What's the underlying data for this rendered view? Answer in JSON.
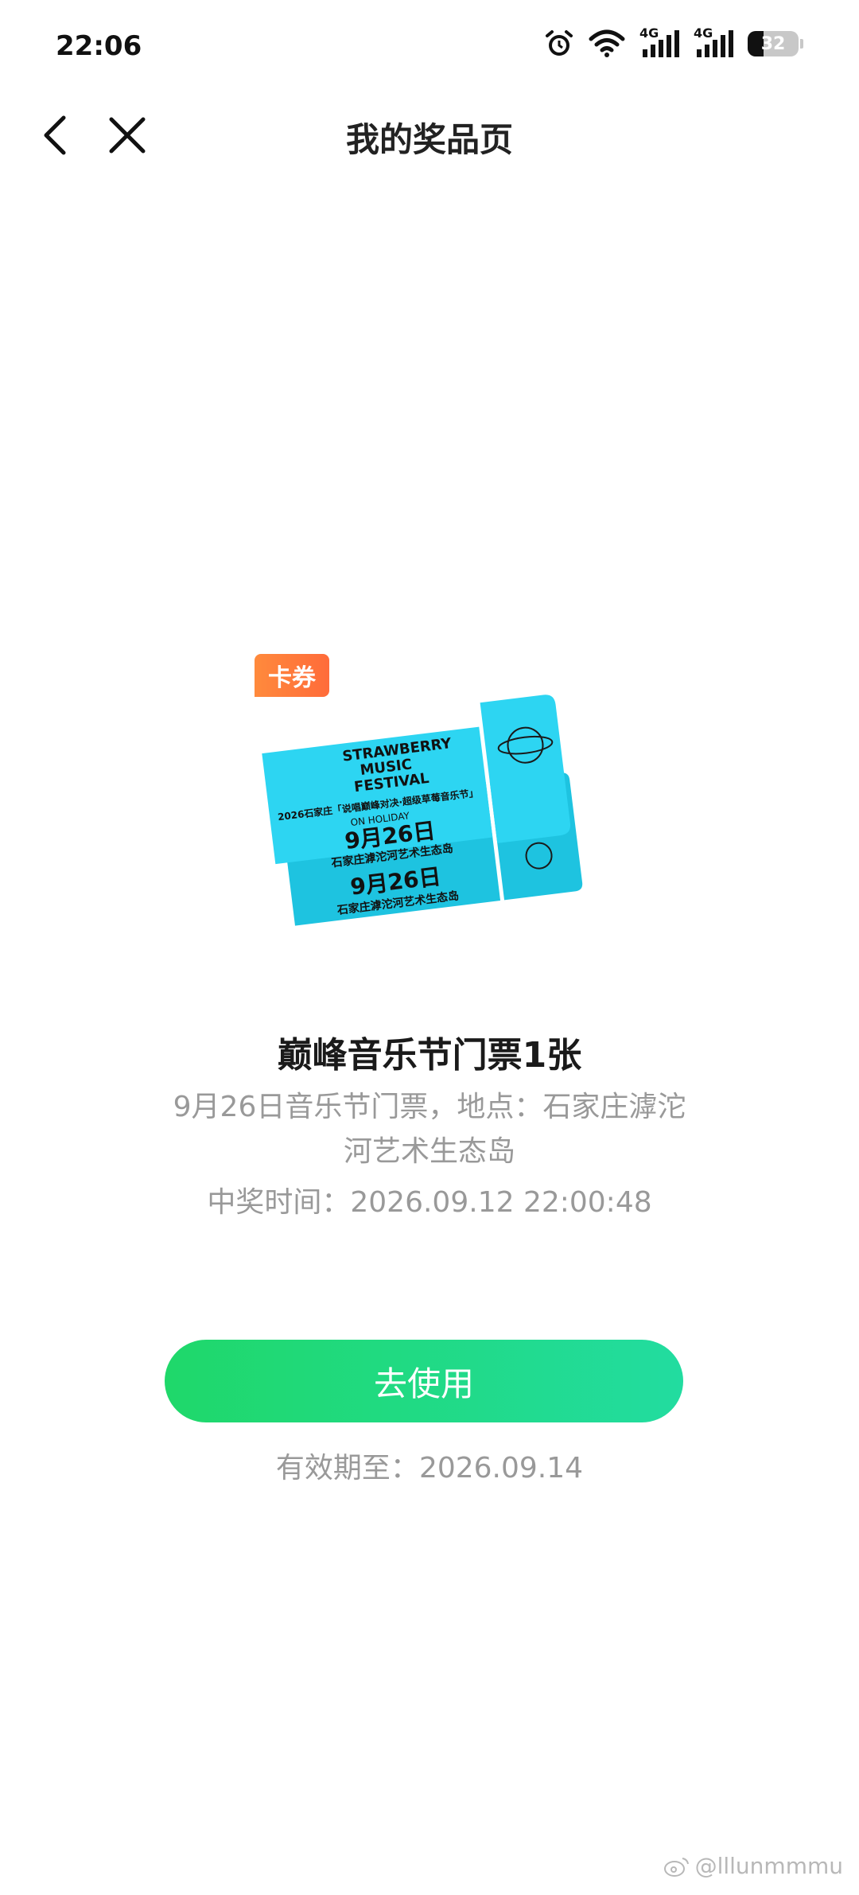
{
  "status_bar": {
    "time": "22:06",
    "network_1": "4G",
    "network_2": "4G",
    "battery_level": "32",
    "battery_fraction": 0.32
  },
  "nav": {
    "title": "我的奖品页",
    "back_icon": "chevron-left-icon",
    "close_icon": "close-icon"
  },
  "prize": {
    "badge": "卡券",
    "ticket_image": {
      "brand_line_1": "STRAWBERRY",
      "brand_line_2": "MUSIC",
      "brand_line_3": "FESTIVAL",
      "event_line": "2026石家庄「说唱巅峰对决·超级草莓音乐节」",
      "subtitle": "ON HOLIDAY",
      "date": "9月26日",
      "venue": "石家庄滹沱河艺术生态岛",
      "color": "#2dd5f2"
    },
    "name": "巅峰音乐节门票1张",
    "description": "9月26日音乐节门票，地点：石家庄滹沱河艺术生态岛",
    "win_time_label": "中奖时间：",
    "win_time_value": "2026.09.12 22:00:48"
  },
  "action": {
    "button_label": "去使用",
    "valid_label": "有效期至：",
    "valid_value": "2026.09.14"
  },
  "watermark": {
    "text": "@lllunmmmu"
  },
  "colors": {
    "button_start": "#1fd86a",
    "button_end": "#22dca0",
    "badge": "#ff7a3a",
    "secondary_text": "#999999"
  }
}
